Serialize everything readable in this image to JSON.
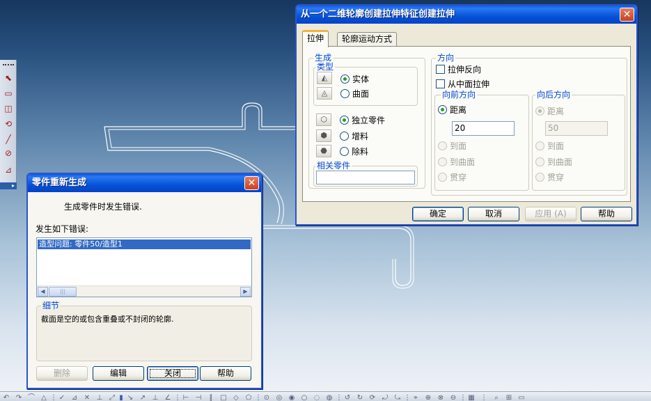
{
  "extrude_dialog": {
    "title": "从一个二维轮廓创建拉伸特征创建拉伸",
    "tabs": [
      "拉伸",
      "轮廓运动方式"
    ],
    "generate": {
      "legend": "生成",
      "type_legend": "类型",
      "type_options": [
        {
          "label": "实体",
          "selected": true
        },
        {
          "label": "曲面",
          "selected": false
        }
      ],
      "part_options": [
        {
          "label": "独立零件",
          "selected": true
        },
        {
          "label": "增料",
          "selected": false
        },
        {
          "label": "除料",
          "selected": false
        }
      ],
      "related_legend": "相关零件",
      "related_value": ""
    },
    "direction": {
      "legend": "方向",
      "reverse_label": "拉伸反向",
      "reverse_checked": false,
      "midplane_label": "从中面拉伸",
      "midplane_checked": false,
      "forward": {
        "legend": "向前方向",
        "distance_label": "距离",
        "distance_value": "20",
        "to_face_label": "到面",
        "to_surface_label": "到曲面",
        "through_label": "贯穿"
      },
      "backward": {
        "legend": "向后方向",
        "distance_label": "距离",
        "distance_value": "50",
        "to_face_label": "到面",
        "to_surface_label": "到曲面",
        "through_label": "贯穿"
      }
    },
    "buttons": {
      "ok": "确定",
      "cancel": "取消",
      "apply": "应用 (A)",
      "help": "帮助"
    }
  },
  "regen_dialog": {
    "title": "零件重新生成",
    "message": "生成零件时发生错误.",
    "errors_label": "发生如下错误:",
    "errors": [
      "造型问题: 零件50/造型1"
    ],
    "details_legend": "细节",
    "details_text": "截面是空的或包含重叠或不封闭的轮廓.",
    "buttons": {
      "delete": "删除",
      "edit": "编辑",
      "close": "关闭",
      "help": "帮助"
    }
  },
  "icons": {
    "left_toolbar": [
      "select-icon",
      "sketch-rect-icon",
      "sketch-frame-icon",
      "rotate-icon",
      "line-icon",
      "circle-icon",
      "dimension-icon"
    ],
    "bottom_toolbar_count": 48
  },
  "colors": {
    "title_bar": "#0553d8",
    "accent_tab": "#f5b33c",
    "legend_text": "#0046d5",
    "selection": "#316ac5"
  }
}
